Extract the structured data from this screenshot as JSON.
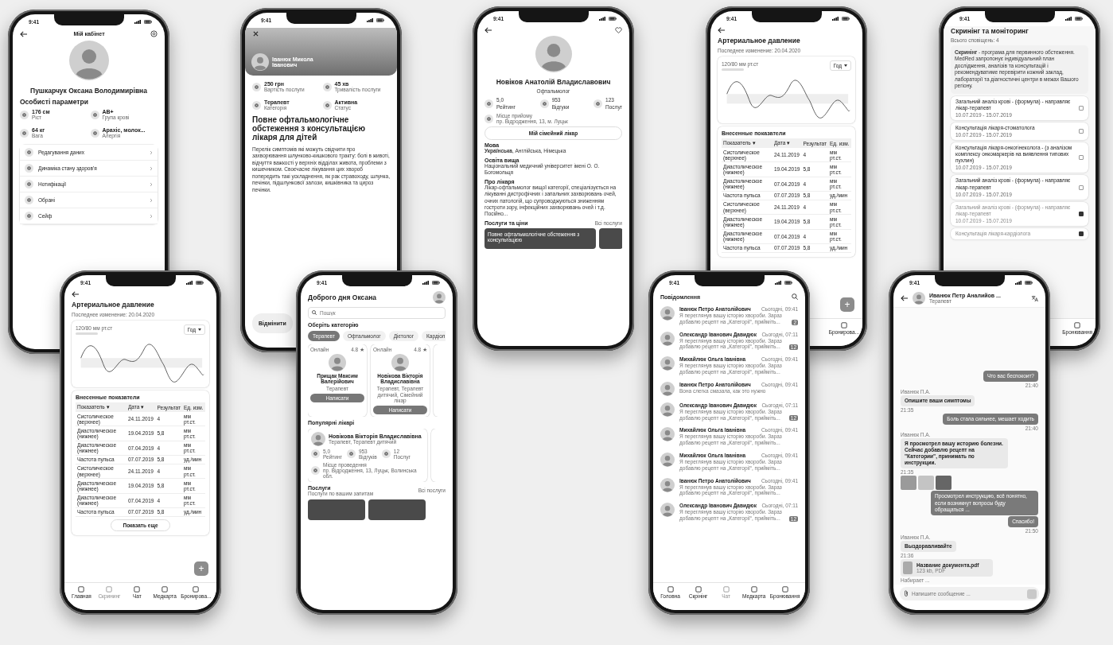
{
  "phones": [
    {
      "kind": "profile",
      "time": "9:41",
      "title": "Мій кабінет",
      "name": "Пушкарчук Оксана Володимирівна",
      "section": "Особисті параметри",
      "params": [
        {
          "value": "176 см",
          "label": "Ріст"
        },
        {
          "value": "АВ+",
          "label": "Група крові"
        },
        {
          "value": "64 кг",
          "label": "Вага"
        },
        {
          "value": "Арахіс, молок...",
          "label": "Алергія"
        }
      ],
      "menu": [
        "Редагування даних",
        "Динаміка стану здоров'я",
        "Нотифікації",
        "Обрані",
        "Сейф"
      ]
    },
    {
      "kind": "service",
      "time": "9:41",
      "doctor": "Іванюк Микола Іванович",
      "stats": [
        {
          "value": "250 грн",
          "label": "Вартість послуги"
        },
        {
          "value": "45 хв",
          "label": "Тривалість послуги"
        },
        {
          "value": "Терапевт",
          "label": "Категорія"
        },
        {
          "value": "Активна",
          "label": "Статус"
        }
      ],
      "title": "Повне офтальмологічне обстеження з консультацією лікаря для дітей",
      "text": "Перелік симптомів які можуть свідчити про захворювання шлунково-кишкового тракту: болі в животі, відчуття важкості у верхніх відділах живота, проблеми з кишечником. Своєчасне лікування цих хвороб попередить такі ускладнення, як рак стравоходу, шлунка, печінки, підшлункової залози, кишківника та цироз печінки.",
      "button": "Відмінити"
    },
    {
      "kind": "doctor",
      "time": "9:41",
      "name": "Новіков Анатолій Владиславович",
      "specialty": "Офтальмолог",
      "stats": [
        {
          "value": "5,0",
          "label": "Рейтинг"
        },
        {
          "value": "953",
          "label": "Відгуки"
        },
        {
          "value": "123",
          "label": "Послуг"
        }
      ],
      "place_label": "Місце прийому",
      "place": "пр. Відродження, 13, м. Луцьк",
      "button": "Мій сімейний лікар",
      "sections": [
        {
          "title": "Мова",
          "text": "**Українська**, Англійська, Німецька"
        },
        {
          "title": "Освіта вища",
          "text": "Національний медичний університет імені О. О. Богомольця"
        },
        {
          "title": "Про лікаря",
          "text": "Лікар-офтальмолог вищої категорії, спеціалізується на лікуванні дистрофічних і запальних захворювань очей, очних патологій, що супроводжуються зниженням гостроти зору, інфекційних захворювань очей і т.д. Посійно..."
        }
      ],
      "services_title": "Послуги та ціни",
      "services_link": "Всі послуги",
      "service_card": "Повне офтальмологічне обстеження з консультацією"
    },
    {
      "kind": "bp",
      "time": "9:41",
      "title": "Артериальное давление",
      "subtitle": "Последнее изменение: 20.04.2020",
      "reading": "120/80 мм рт.ст",
      "period": "Год",
      "table_title": "Внесенные показатели",
      "columns": [
        "Показатель ▾",
        "Дата ▾",
        "Результат",
        "Ед. изм."
      ],
      "rows": [
        [
          "Систолическое (верхнее)",
          "24.11.2019",
          "4",
          "мм рт.ст."
        ],
        [
          "Диастолическое (нижнее)",
          "19.04.2019",
          "5,8",
          "мм рт.ст."
        ],
        [
          "Диастолическое (нижнее)",
          "07.04.2019",
          "4",
          "мм рт.ст."
        ],
        [
          "Частота пульса",
          "07.07.2019",
          "5,8",
          "уд./мин"
        ],
        [
          "Систолическое (верхнее)",
          "24.11.2019",
          "4",
          "мм рт.ст."
        ],
        [
          "Диастолическое (нижнее)",
          "19.04.2019",
          "5,8",
          "мм рт.ст."
        ],
        [
          "Диастолическое (нижнее)",
          "07.04.2019",
          "4",
          "мм рт.ст."
        ],
        [
          "Частота пульса",
          "07.07.2019",
          "5,8",
          "уд./мин"
        ]
      ],
      "fab": "+",
      "tabs": [
        {
          "label": "Бронирова...",
          "selected": false
        }
      ]
    },
    {
      "kind": "screening",
      "time": "9:41",
      "title": "Скринінг та моніторинг",
      "subtitle": "Всього сповіщень: 4",
      "info": "**Скринінг** - програма для первинного обстеження. MedRed запропонує індивідуальний план дослідження, аналізів та консультацій і рекомендуватиме перевірити кожний заклад, лабораторії та діагностичні центри в межах Вашого регіону.",
      "items": [
        {
          "title": "Загальний аналіз крові - (формула) - направляє лікар-терапевт",
          "dates": "10.07.2019 - 15.07.2019",
          "checked": false
        },
        {
          "title": "Консультація лікаря-стоматолога",
          "dates": "10.07.2019 - 15.07.2019",
          "checked": false
        },
        {
          "title": "Консультація лікаря-онкогінеколога - (з аналізом комплексу онкомаркерів на виявлення типових пухлин)",
          "dates": "10.07.2019 - 15.07.2019",
          "checked": false
        },
        {
          "title": "Загальний аналіз крові - (формула) - направляє лікар-терапевт",
          "dates": "10.07.2019 - 15.07.2019",
          "checked": false
        },
        {
          "title": "Загальний аналіз крові - (формула) - направляє лікар-терапевт",
          "dates": "10.07.2019 - 15.07.2019",
          "checked": true
        },
        {
          "title": "Консультація лікаря-кардіолога",
          "checked": true
        }
      ],
      "tabs": [
        {
          "label": "Бронювання",
          "selected": false
        }
      ]
    },
    {
      "kind": "bp",
      "time": "9:41",
      "title": "Артериальное давление",
      "subtitle": "Последнее изменение: 20.04.2020",
      "reading": "120/80 мм рт.ст",
      "period": "Год",
      "table_title": "Внесенные показатели",
      "columns": [
        "Показатель ▾",
        "Дата ▾",
        "Результат",
        "Ед. изм."
      ],
      "rows": [
        [
          "Систолическое (верхнее)",
          "24.11.2019",
          "4",
          "мм рт.ст."
        ],
        [
          "Диастолическое (нижнее)",
          "19.04.2019",
          "5,8",
          "мм рт.ст."
        ],
        [
          "Диастолическое (нижнее)",
          "07.04.2019",
          "4",
          "мм рт.ст."
        ],
        [
          "Частота пульса",
          "07.07.2019",
          "5,8",
          "уд./мин"
        ],
        [
          "Систолическое (верхнее)",
          "24.11.2019",
          "4",
          "мм рт.ст."
        ],
        [
          "Диастолическое (нижнее)",
          "19.04.2019",
          "5,8",
          "мм рт.ст."
        ],
        [
          "Диастолическое (нижнее)",
          "07.04.2019",
          "4",
          "мм рт.ст."
        ],
        [
          "Частота пульса",
          "07.07.2019",
          "5,8",
          "уд./мин"
        ]
      ],
      "more": "Показать еще",
      "fab": "+",
      "tabs": [
        {
          "label": "Главная",
          "selected": false
        },
        {
          "label": "Скрининг",
          "selected": true
        },
        {
          "label": "Чат",
          "selected": false
        },
        {
          "label": "Медкарта",
          "selected": false
        },
        {
          "label": "Бронирова...",
          "selected": false
        }
      ]
    },
    {
      "kind": "home",
      "time": "9:41",
      "greeting": "Доброго дня Оксана",
      "placeholder": "Пошук",
      "categories_title": "Оберіть категорію",
      "chips": [
        {
          "label": "Терапевт",
          "selected": true
        },
        {
          "label": "Офтальмолог",
          "selected": false
        },
        {
          "label": "Дієтолог",
          "selected": false
        },
        {
          "label": "Кардіол",
          "selected": false
        }
      ],
      "doctors": [
        {
          "status": "Онлайн",
          "rating": "4.8 ★",
          "name": "Прищак Максим Валерійович",
          "role": "Терапевт",
          "button": "Написати"
        },
        {
          "status": "Онлайн",
          "rating": "4.8 ★",
          "name": "Новікова Вікторія Владиславівна",
          "role": "Терапевт, Терапевт дитячий, Сімейний лікар",
          "button": "Написати"
        }
      ],
      "popular_title": "Популярні лікарі",
      "popular": {
        "name": "Новікова Вікторія Владиславівна",
        "role": "Терапевт, Терапевт дитячий",
        "stats": [
          {
            "value": "5,0",
            "label": "Рейтинг"
          },
          {
            "value": "953",
            "label": "Відгуків"
          },
          {
            "value": "12",
            "label": "Послуг"
          }
        ],
        "place_label": "Місце проведення",
        "place": "пр. Відродження, 13, Луцьк, Волинська обл."
      },
      "services_title": "Послуги",
      "services_subtitle": "Послуги по вашим запитам",
      "services_link": "Всі послуги"
    },
    {
      "kind": "messages",
      "time": "9:41",
      "title": "Повідомлення",
      "chats": [
        {
          "name": "Іванюк Петро Анатолійович",
          "preview": "Я переглянув вашу історію хвороби. Зараз добавлю рецепт на „Категорії“, прийміть...",
          "time": "Сьогодні, 09:41",
          "unread": "2"
        },
        {
          "name": "Олександр Іванович Давидюк",
          "preview": "Я переглянув вашу історію хвороби. Зараз добавлю рецепт на „Категорії“, прийміть...",
          "time": "Сьогодні, 07:11",
          "unread": "12"
        },
        {
          "name": "Михайлюк Ольга Іванівна",
          "preview": "Я переглянув вашу історію хвороби. Зараз добавлю рецепт на „Категорії“, прийміть...",
          "time": "Сьогодні, 09:41"
        },
        {
          "name": "Іванюк Петро Анатолійович",
          "preview": "Вона слегка смазала, как это нужно",
          "time": "Сьогодні, 09:41"
        },
        {
          "name": "Олександр Іванович Давидюк",
          "preview": "Я переглянув вашу історію хвороби. Зараз добавлю рецепт на „Категорії“, прийміть...",
          "time": "Сьогодні, 07:11",
          "unread": "12"
        },
        {
          "name": "Михайлюк Ольга Іванівна",
          "preview": "Я переглянув вашу історію хвороби. Зараз добавлю рецепт на „Категорії“, прийміть...",
          "time": "Сьогодні, 09:41"
        },
        {
          "name": "Михайлюк Ольга Іванівна",
          "preview": "Я переглянув вашу історію хвороби. Зараз добавлю рецепт на „Категорії“, прийміть...",
          "time": "Сьогодні, 09:41"
        },
        {
          "name": "Іванюк Петро Анатолійович",
          "preview": "Я переглянув вашу історію хвороби. Зараз добавлю рецепт на „Категорії“, прийміть...",
          "time": "Сьогодні, 09:41"
        },
        {
          "name": "Олександр Іванович Давидюк",
          "preview": "Я переглянув вашу історію хвороби. Зараз добавлю рецепт на „Категорії“, прийміть...",
          "time": "Сьогодні, 07:11",
          "unread": "12"
        }
      ],
      "tabs": [
        {
          "label": "Головна",
          "selected": false
        },
        {
          "label": "Скрінінг",
          "selected": false
        },
        {
          "label": "Чат",
          "selected": true
        },
        {
          "label": "Медкарта",
          "selected": false
        },
        {
          "label": "Бронювання",
          "selected": false
        }
      ]
    },
    {
      "kind": "chat",
      "time": "9:41",
      "name": "Иванюк Петр Аналийов ...",
      "role": "Терапевт",
      "messages": [
        {
          "kind": "out",
          "text": "Что вас беспокоит?",
          "time": "21:40"
        },
        {
          "kind": "in",
          "author": "Иванюк П.А.",
          "text": "Опишите ваши симптомы",
          "time": "21:35"
        },
        {
          "kind": "out",
          "text": "Боль стала сильнее, мешает ходить",
          "time": "21:40"
        },
        {
          "kind": "in",
          "author": "Иванюк П.А.",
          "text": "Я просмотрел вашу историю болезни. Сейчас добавлю рецепт на \"Категории\", принимать по инструкции.",
          "time": "21:35"
        },
        {
          "kind": "images"
        },
        {
          "kind": "out",
          "text": "Просмотрел инструкцию, всё понятно, если возникнут вопросы буду обращаться ..."
        },
        {
          "kind": "out",
          "text": "Спасибо!",
          "time": "21:50"
        },
        {
          "kind": "in",
          "author": "Иванюк П.А.",
          "text": "Выздоравливайте",
          "time": "21:36"
        },
        {
          "kind": "file",
          "title": "Название документа.pdf",
          "meta": "123 kb, PDF"
        },
        {
          "kind": "typing",
          "text": "Набирает ..."
        }
      ],
      "placeholder": "Напишите сообщение ..."
    }
  ]
}
